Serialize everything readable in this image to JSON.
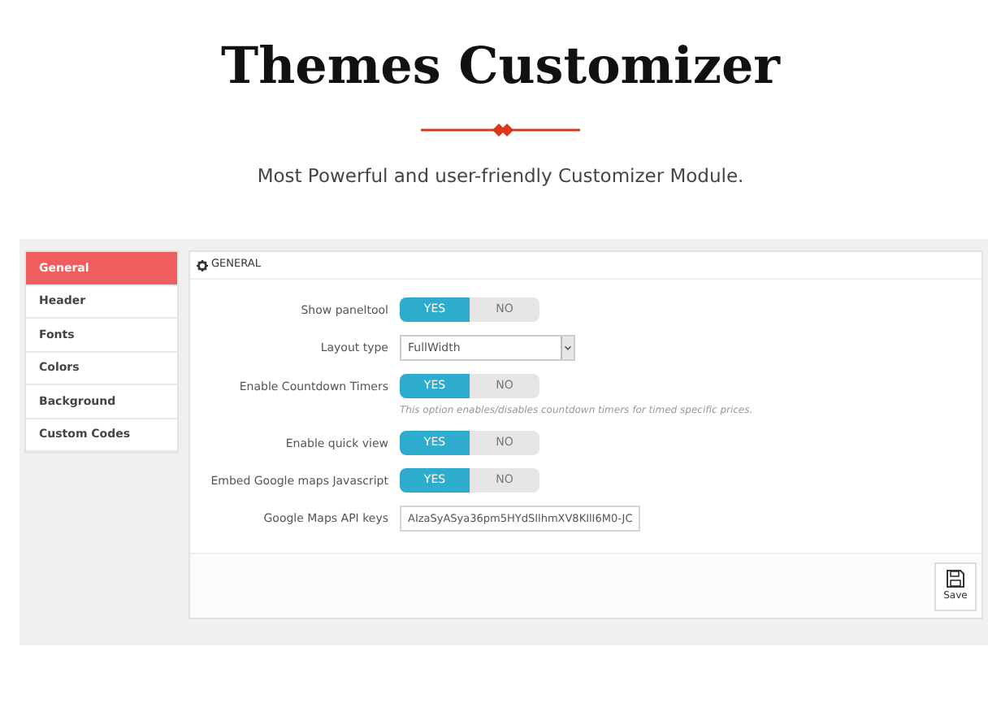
{
  "header": {
    "title": "Themes Customizer",
    "subtitle": "Most Powerful and user-friendly Customizer Module."
  },
  "sidebar": {
    "items": [
      {
        "label": "General",
        "selected": true
      },
      {
        "label": "Header",
        "selected": false
      },
      {
        "label": "Fonts",
        "selected": false
      },
      {
        "label": "Colors",
        "selected": false
      },
      {
        "label": "Background",
        "selected": false
      },
      {
        "label": "Custom Codes",
        "selected": false
      }
    ]
  },
  "panel": {
    "title": "GENERAL",
    "fields": [
      {
        "kind": "toggle",
        "label": "Show paneltool",
        "options": [
          {
            "label": "YES",
            "selected": true
          },
          {
            "label": "NO",
            "selected": false
          }
        ]
      },
      {
        "kind": "select",
        "label": "Layout type",
        "value": "FullWidth"
      },
      {
        "kind": "toggle",
        "label": "Enable Countdown Timers",
        "options": [
          {
            "label": "YES",
            "selected": true
          },
          {
            "label": "NO",
            "selected": false
          }
        ],
        "help": "This option enables/disables countdown timers for timed specific prices."
      },
      {
        "kind": "toggle",
        "label": "Enable quick view",
        "options": [
          {
            "label": "YES",
            "selected": true
          },
          {
            "label": "NO",
            "selected": false
          }
        ]
      },
      {
        "kind": "toggle",
        "label": "Embed Google maps Javascript",
        "options": [
          {
            "label": "YES",
            "selected": true
          },
          {
            "label": "NO",
            "selected": false
          }
        ]
      },
      {
        "kind": "text",
        "label": "Google Maps API keys",
        "value": "AIzaSyASya36pm5HYdSIlhmXV8KIlI6M0-JC"
      }
    ],
    "save": "Save"
  }
}
